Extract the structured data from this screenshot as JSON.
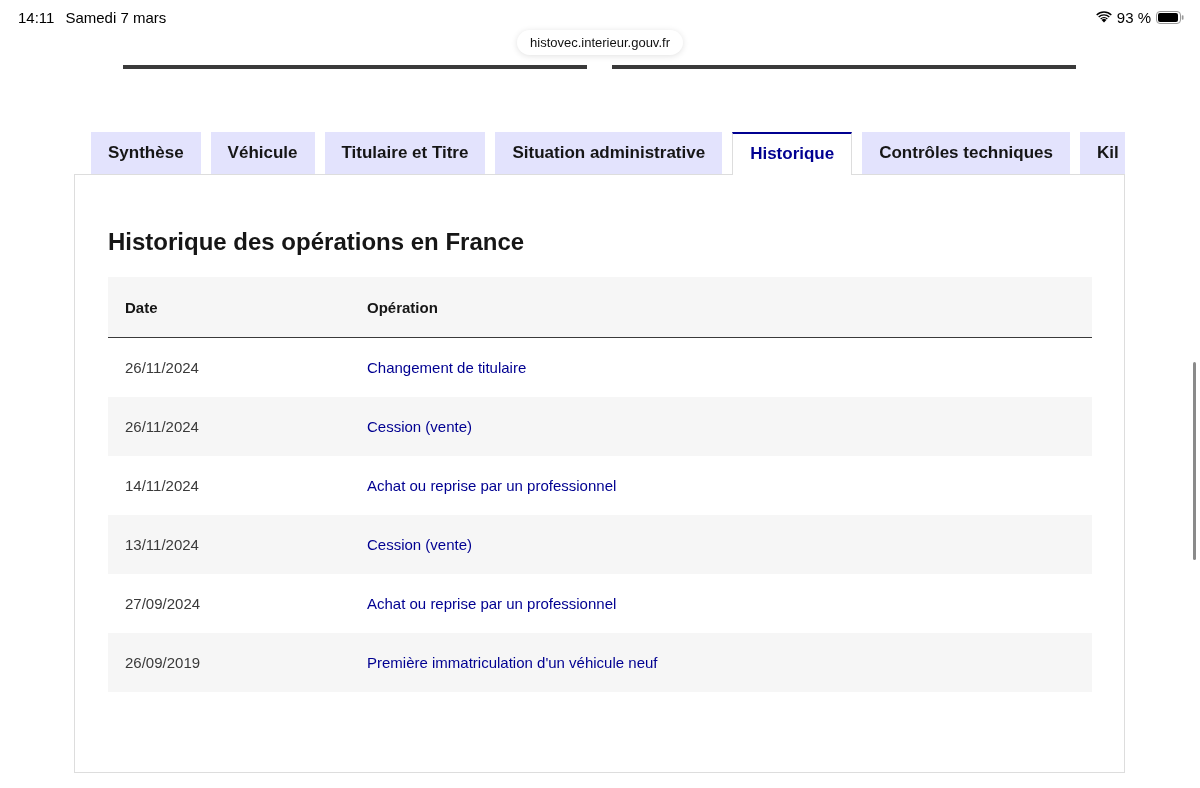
{
  "status_bar": {
    "time": "14:11",
    "date": "Samedi 7 mars",
    "battery_text": "93 %"
  },
  "address_bar": {
    "url": "histovec.interieur.gouv.fr"
  },
  "tabs": [
    {
      "label": "Synthèse",
      "selected": false
    },
    {
      "label": "Véhicule",
      "selected": false
    },
    {
      "label": "Titulaire et Titre",
      "selected": false
    },
    {
      "label": "Situation administrative",
      "selected": false
    },
    {
      "label": "Historique",
      "selected": true
    },
    {
      "label": "Contrôles techniques",
      "selected": false
    },
    {
      "label": "Kil",
      "selected": false
    }
  ],
  "panel": {
    "title": "Historique des opérations en France",
    "table": {
      "columns": [
        "Date",
        "Opération"
      ],
      "rows": [
        {
          "date": "26/11/2024",
          "operation": "Changement de titulaire"
        },
        {
          "date": "26/11/2024",
          "operation": "Cession (vente)"
        },
        {
          "date": "14/11/2024",
          "operation": "Achat ou reprise par un professionnel"
        },
        {
          "date": "13/11/2024",
          "operation": "Cession (vente)"
        },
        {
          "date": "27/09/2024",
          "operation": "Achat ou reprise par un professionnel"
        },
        {
          "date": "26/09/2019",
          "operation": "Première immatriculation d'un véhicule neuf"
        }
      ]
    }
  }
}
